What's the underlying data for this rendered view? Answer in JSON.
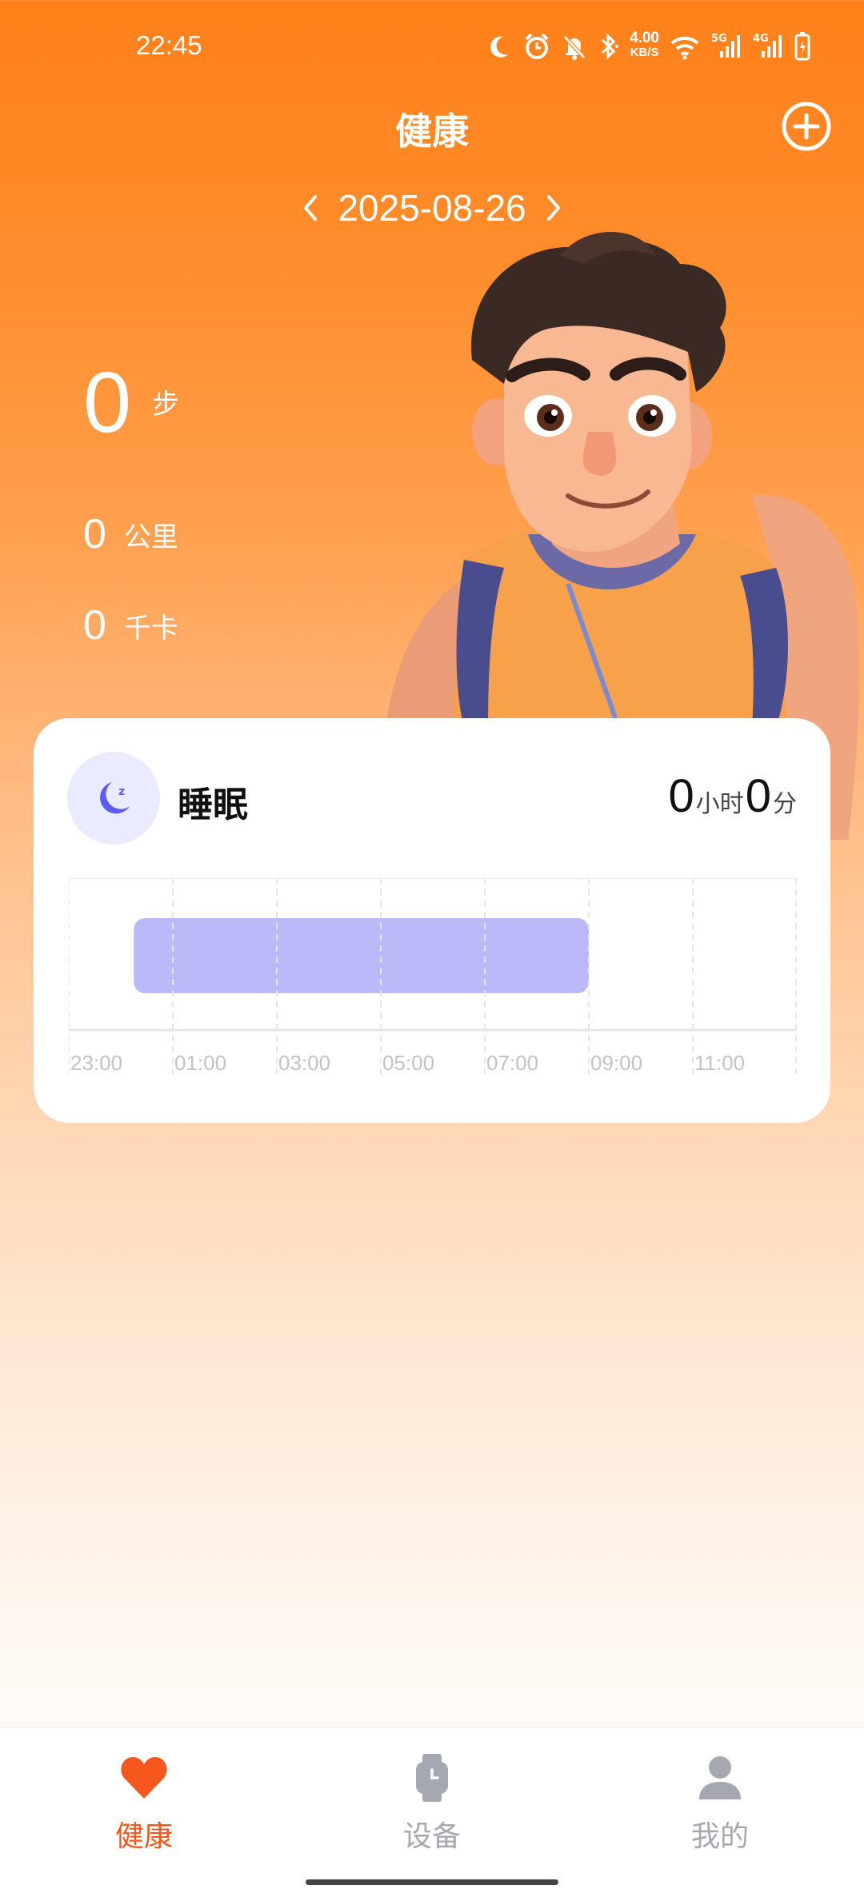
{
  "status_bar": {
    "time": "22:45",
    "net_speed_value": "4.00",
    "net_speed_unit": "KB/S",
    "icons": [
      "moon-icon",
      "alarm-icon",
      "bell-off-icon",
      "bluetooth-icon",
      "wifi-icon",
      "signal-5g-icon",
      "signal-4g-icon",
      "battery-icon"
    ]
  },
  "header": {
    "title": "健康",
    "add_icon": "plus-circle-icon"
  },
  "date_nav": {
    "date": "2025-08-26",
    "prev_icon": "chevron-left-icon",
    "next_icon": "chevron-right-icon"
  },
  "metrics": {
    "steps": {
      "value": "0",
      "unit": "步"
    },
    "distance": {
      "value": "0",
      "unit": "公里"
    },
    "calories": {
      "value": "0",
      "unit": "千卡"
    }
  },
  "sleep_card": {
    "title": "睡眠",
    "icon": "moon-zzz-icon",
    "hours": "0",
    "hours_unit": "小时",
    "minutes": "0",
    "minutes_unit": "分"
  },
  "chart_data": {
    "type": "bar",
    "x_tick_labels": [
      "23:00",
      "01:00",
      "03:00",
      "05:00",
      "07:00",
      "09:00",
      "11:00"
    ],
    "xlim": [
      "23:00",
      "13:00"
    ],
    "bars": [
      {
        "start": "00:15",
        "end": "09:00"
      }
    ],
    "bar_color": "#babaf9",
    "grid": true,
    "title": "",
    "xlabel": "",
    "ylabel": ""
  },
  "bottom_nav": {
    "items": [
      {
        "label": "健康",
        "icon": "heart-icon",
        "active": true
      },
      {
        "label": "设备",
        "icon": "watch-icon",
        "active": false
      },
      {
        "label": "我的",
        "icon": "person-icon",
        "active": false
      }
    ],
    "active_color": "#f5571d",
    "inactive_color": "#a5a8b0"
  },
  "colors": {
    "accent_orange": "#ff8019",
    "sleep_accent": "#5a5ef0"
  }
}
